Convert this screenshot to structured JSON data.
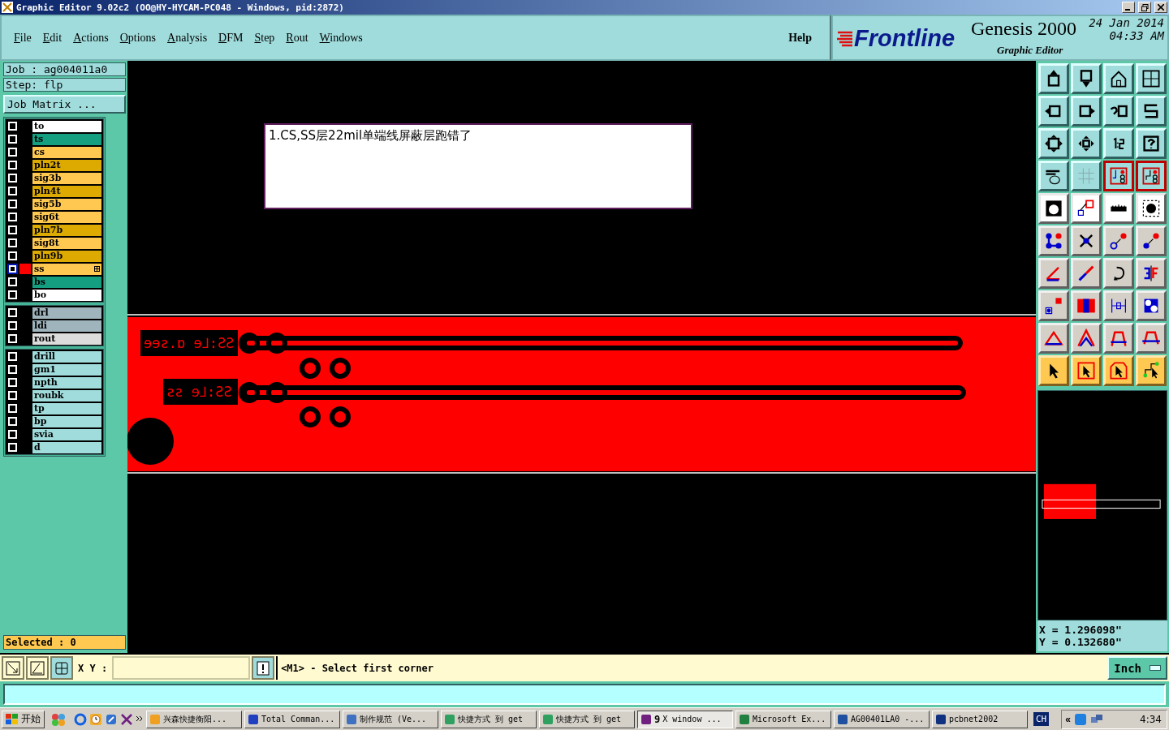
{
  "window": {
    "title": "Graphic Editor 9.02c2 (OO@HY-HYCAM-PC048 - Windows, pid:2872)"
  },
  "menu": [
    "File",
    "Edit",
    "Actions",
    "Options",
    "Analysis",
    "DFM",
    "Step",
    "Rout",
    "Windows"
  ],
  "help": "Help",
  "brand": {
    "logo": "Frontline",
    "product": "Genesis 2000",
    "subtitle": "Graphic Editor",
    "date": "24 Jan 2014",
    "time": "04:33 AM"
  },
  "job": {
    "job": "Job : ag004011a0",
    "step": "Step: flp",
    "matrix_button": "Job Matrix ..."
  },
  "layer_groups": [
    {
      "layers": [
        {
          "name": "to",
          "color": "#ffffff",
          "displayed": false,
          "work": false
        },
        {
          "name": "ts",
          "color": "#14a080",
          "displayed": false,
          "work": false
        },
        {
          "name": "cs",
          "color": "#ffc850",
          "displayed": false,
          "work": false
        },
        {
          "name": "pln2t",
          "color": "#dcaa00",
          "displayed": false,
          "work": false
        },
        {
          "name": "sig3b",
          "color": "#ffc850",
          "displayed": false,
          "work": false
        },
        {
          "name": "pln4t",
          "color": "#dcaa00",
          "displayed": false,
          "work": false
        },
        {
          "name": "sig5b",
          "color": "#ffc850",
          "displayed": false,
          "work": false
        },
        {
          "name": "sig6t",
          "color": "#ffc850",
          "displayed": false,
          "work": false
        },
        {
          "name": "pln7b",
          "color": "#dcaa00",
          "displayed": false,
          "work": false
        },
        {
          "name": "sig8t",
          "color": "#ffc850",
          "displayed": false,
          "work": false
        },
        {
          "name": "pln9b",
          "color": "#dcaa00",
          "displayed": false,
          "work": false
        },
        {
          "name": "ss",
          "color": "#ffc850",
          "displayed": true,
          "work": true
        },
        {
          "name": "bs",
          "color": "#14a080",
          "displayed": false,
          "work": false
        },
        {
          "name": "bo",
          "color": "#ffffff",
          "displayed": false,
          "work": false
        }
      ]
    },
    {
      "layers": [
        {
          "name": "drl",
          "color": "#a0b4be",
          "displayed": false,
          "work": false
        },
        {
          "name": "ldi",
          "color": "#a0b4be",
          "displayed": false,
          "work": false
        },
        {
          "name": "rout",
          "color": "#dcdcdc",
          "displayed": false,
          "work": false
        }
      ]
    },
    {
      "layers": [
        {
          "name": "drill",
          "color": "#a0dcdc",
          "displayed": false,
          "work": false
        },
        {
          "name": "gm1",
          "color": "#a0dcdc",
          "displayed": false,
          "work": false
        },
        {
          "name": "npth",
          "color": "#a0dcdc",
          "displayed": false,
          "work": false
        },
        {
          "name": "roubk",
          "color": "#a0dcdc",
          "displayed": false,
          "work": false
        },
        {
          "name": "tp",
          "color": "#a0dcdc",
          "displayed": false,
          "work": false
        },
        {
          "name": "bp",
          "color": "#a0dcdc",
          "displayed": false,
          "work": false
        },
        {
          "name": "svia",
          "color": "#a0dcdc",
          "displayed": false,
          "work": false
        },
        {
          "name": "d",
          "color": "#a0dcdc",
          "displayed": false,
          "work": false
        }
      ]
    }
  ],
  "selected_count": "Selected : 0",
  "canvas": {
    "note": "1.CS,SS层22mil单端线屏蔽层跑错了",
    "labels": [
      "ɘɘƨ.ɒ ɘ⅃:ƧƧ",
      "ƨƨ ɘ⅃:ƧƧ"
    ]
  },
  "toolbar": [
    {
      "kind": "view",
      "buttons": [
        {
          "active": false
        },
        {
          "active": false
        },
        {
          "active": false
        },
        {
          "active": false
        }
      ]
    },
    {
      "kind": "view",
      "buttons": [
        {
          "active": false
        },
        {
          "active": false
        },
        {
          "active": false
        },
        {
          "active": false
        }
      ]
    },
    {
      "kind": "view",
      "buttons": [
        {
          "active": false
        },
        {
          "active": false
        },
        {
          "active": false
        },
        {
          "active": false
        }
      ]
    },
    {
      "kind": "view",
      "buttons": [
        {
          "active": false
        },
        {
          "active": false
        },
        {
          "active": true
        },
        {
          "active": true
        }
      ]
    },
    {
      "kind": "display",
      "buttons": [
        {
          "active": false
        },
        {
          "active": false
        },
        {
          "active": false
        },
        {
          "active": false
        }
      ]
    },
    {
      "kind": "edit",
      "buttons": [
        {
          "active": false
        },
        {
          "active": false
        },
        {
          "active": false
        },
        {
          "active": false
        }
      ]
    },
    {
      "kind": "edit",
      "buttons": [
        {
          "active": false
        },
        {
          "active": false
        },
        {
          "active": false
        },
        {
          "active": false
        }
      ]
    },
    {
      "kind": "edit",
      "buttons": [
        {
          "active": false
        },
        {
          "active": false
        },
        {
          "active": false
        },
        {
          "active": false
        }
      ]
    },
    {
      "kind": "edit",
      "buttons": [
        {
          "active": false
        },
        {
          "active": false
        },
        {
          "active": false
        },
        {
          "active": false
        }
      ]
    },
    {
      "kind": "select",
      "buttons": [
        {
          "active": false
        },
        {
          "active": false
        },
        {
          "active": false
        },
        {
          "active": false
        }
      ]
    }
  ],
  "coordinates": {
    "x": "X = 1.296098\"",
    "y": "Y = 0.132680\""
  },
  "command_bar": {
    "xy_label": "X Y :",
    "prompt": "<M1> - Select first corner",
    "units": "Inch"
  },
  "taskbar": {
    "start": "开始",
    "tasks": [
      {
        "label": "兴森快捷衡阳...",
        "active": false
      },
      {
        "label": "Total Comman...",
        "active": false
      },
      {
        "label": "制作规范 (Ve...",
        "active": false
      },
      {
        "label": "快捷方式 到 get",
        "active": false
      },
      {
        "label": "快捷方式 到 get",
        "active": false
      },
      {
        "label": "X window ...",
        "count": "9",
        "active": true
      },
      {
        "label": "Microsoft Ex...",
        "active": false
      },
      {
        "label": "AG00401LA0 -...",
        "active": false
      },
      {
        "label": "pcbnet2002",
        "active": false
      }
    ],
    "language": "CH",
    "tray_toggle": "«",
    "clock": "4:34"
  }
}
